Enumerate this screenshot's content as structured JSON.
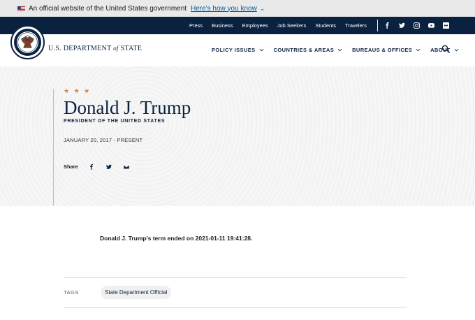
{
  "gov_banner": {
    "text": "An official website of the United States government",
    "link": "Here's how you know"
  },
  "utility_nav": {
    "links": [
      "Press",
      "Business",
      "Employees",
      "Job Seekers",
      "Students",
      "Travelers"
    ],
    "social_icons": [
      "facebook-icon",
      "twitter-icon",
      "instagram-icon",
      "youtube-icon",
      "flickr-icon"
    ]
  },
  "header": {
    "wordmark_prefix": "U.S. DEPARTMENT",
    "wordmark_of": "of",
    "wordmark_suffix": "STATE",
    "nav": [
      "POLICY ISSUES",
      "COUNTRIES & AREAS",
      "BUREAUS & OFFICES",
      "ABOUT"
    ]
  },
  "hero": {
    "stars": "★ ★ ★",
    "name": "Donald J. Trump",
    "subtitle": "PRESIDENT OF THE UNITED STATES",
    "dates": "JANUARY 20, 2017 - PRESENT",
    "share_label": "Share"
  },
  "content": {
    "term_text": "Donald J. Trump's term ended on 2021-01-11 19:41:28.",
    "tags_label": "TAGS",
    "tags": [
      "State Department Official"
    ]
  },
  "colors": {
    "navy": "#0a2240",
    "gold": "#c28a4a",
    "link_blue": "#005ea2"
  }
}
